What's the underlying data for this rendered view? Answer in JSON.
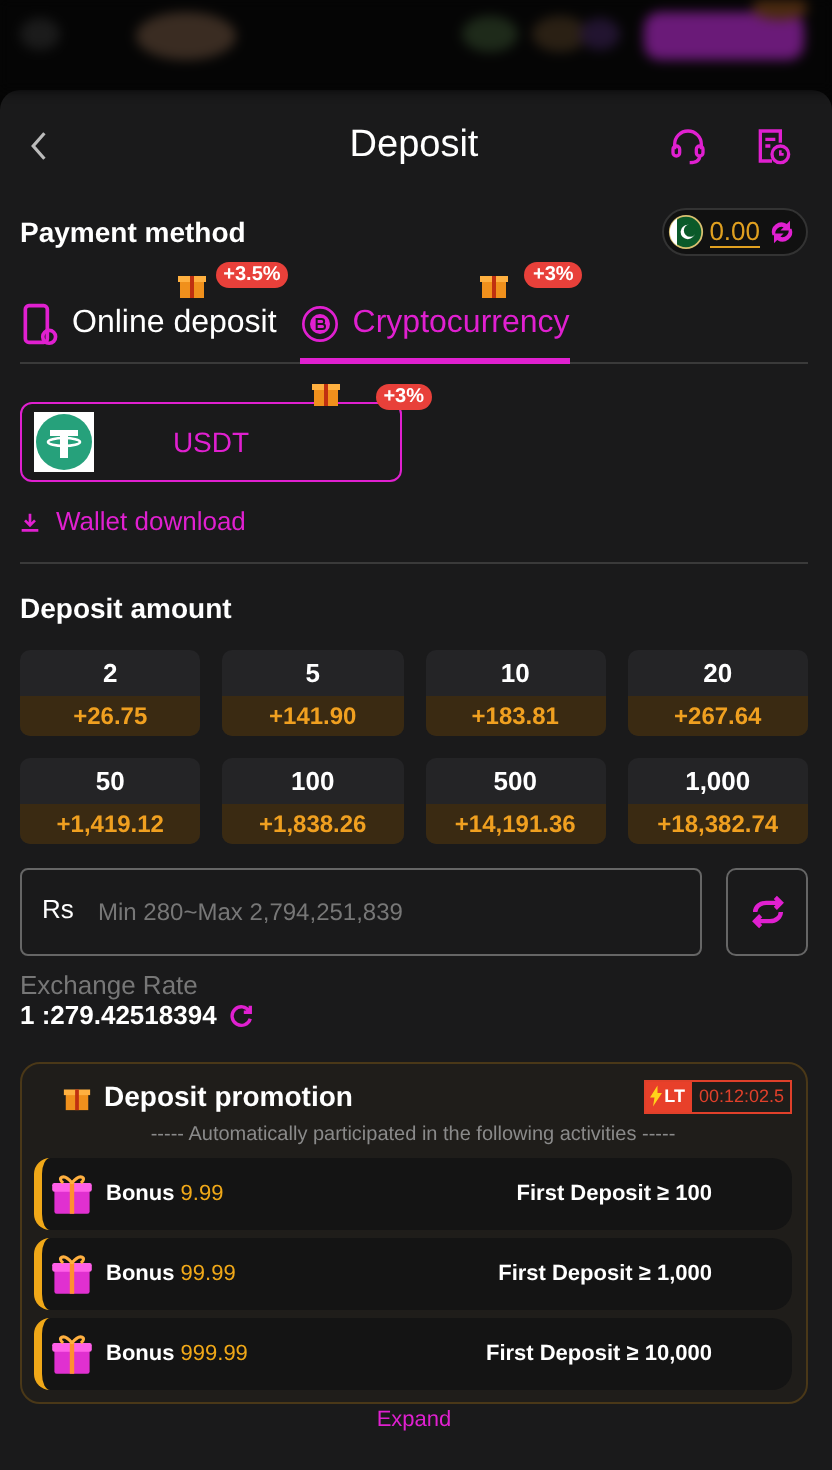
{
  "header": {
    "title": "Deposit"
  },
  "payment_method": {
    "label": "Payment method",
    "balance": "0.00"
  },
  "tabs": [
    {
      "kind": "phone",
      "label": "Online deposit",
      "bonus": "+3.5%",
      "selected": false
    },
    {
      "kind": "crypto",
      "label": "Cryptocurrency",
      "bonus": "+3%",
      "selected": true
    }
  ],
  "channels": [
    {
      "name": "USDT",
      "bonus": "+3%",
      "selected": true
    }
  ],
  "wallet_download": "Wallet download",
  "deposit_amount": {
    "label": "Deposit amount",
    "options": [
      {
        "amount": "2",
        "bonus": "+26.75"
      },
      {
        "amount": "5",
        "bonus": "+141.90"
      },
      {
        "amount": "10",
        "bonus": "+183.81"
      },
      {
        "amount": "20",
        "bonus": "+267.64"
      },
      {
        "amount": "50",
        "bonus": "+1,419.12"
      },
      {
        "amount": "100",
        "bonus": "+1,838.26"
      },
      {
        "amount": "500",
        "bonus": "+14,191.36"
      },
      {
        "amount": "1,000",
        "bonus": "+18,382.74"
      }
    ]
  },
  "amount_field": {
    "currency": "Rs",
    "placeholder": "Min 280~Max 2,794,251,839"
  },
  "exchange_rate": {
    "label": "Exchange Rate",
    "value": "1 :279.42518394"
  },
  "promotion": {
    "title": "Deposit promotion",
    "badge": "LT",
    "countdown": "00:12:02.5",
    "subtitle": "----- Automatically participated in the following activities -----",
    "items": [
      {
        "label": "Bonus",
        "amount": "9.99",
        "condition": "First Deposit ≥ 100"
      },
      {
        "label": "Bonus",
        "amount": "99.99",
        "condition": "First Deposit ≥ 1,000"
      },
      {
        "label": "Bonus",
        "amount": "999.99",
        "condition": "First Deposit ≥ 10,000"
      }
    ]
  },
  "expand": "Expand"
}
